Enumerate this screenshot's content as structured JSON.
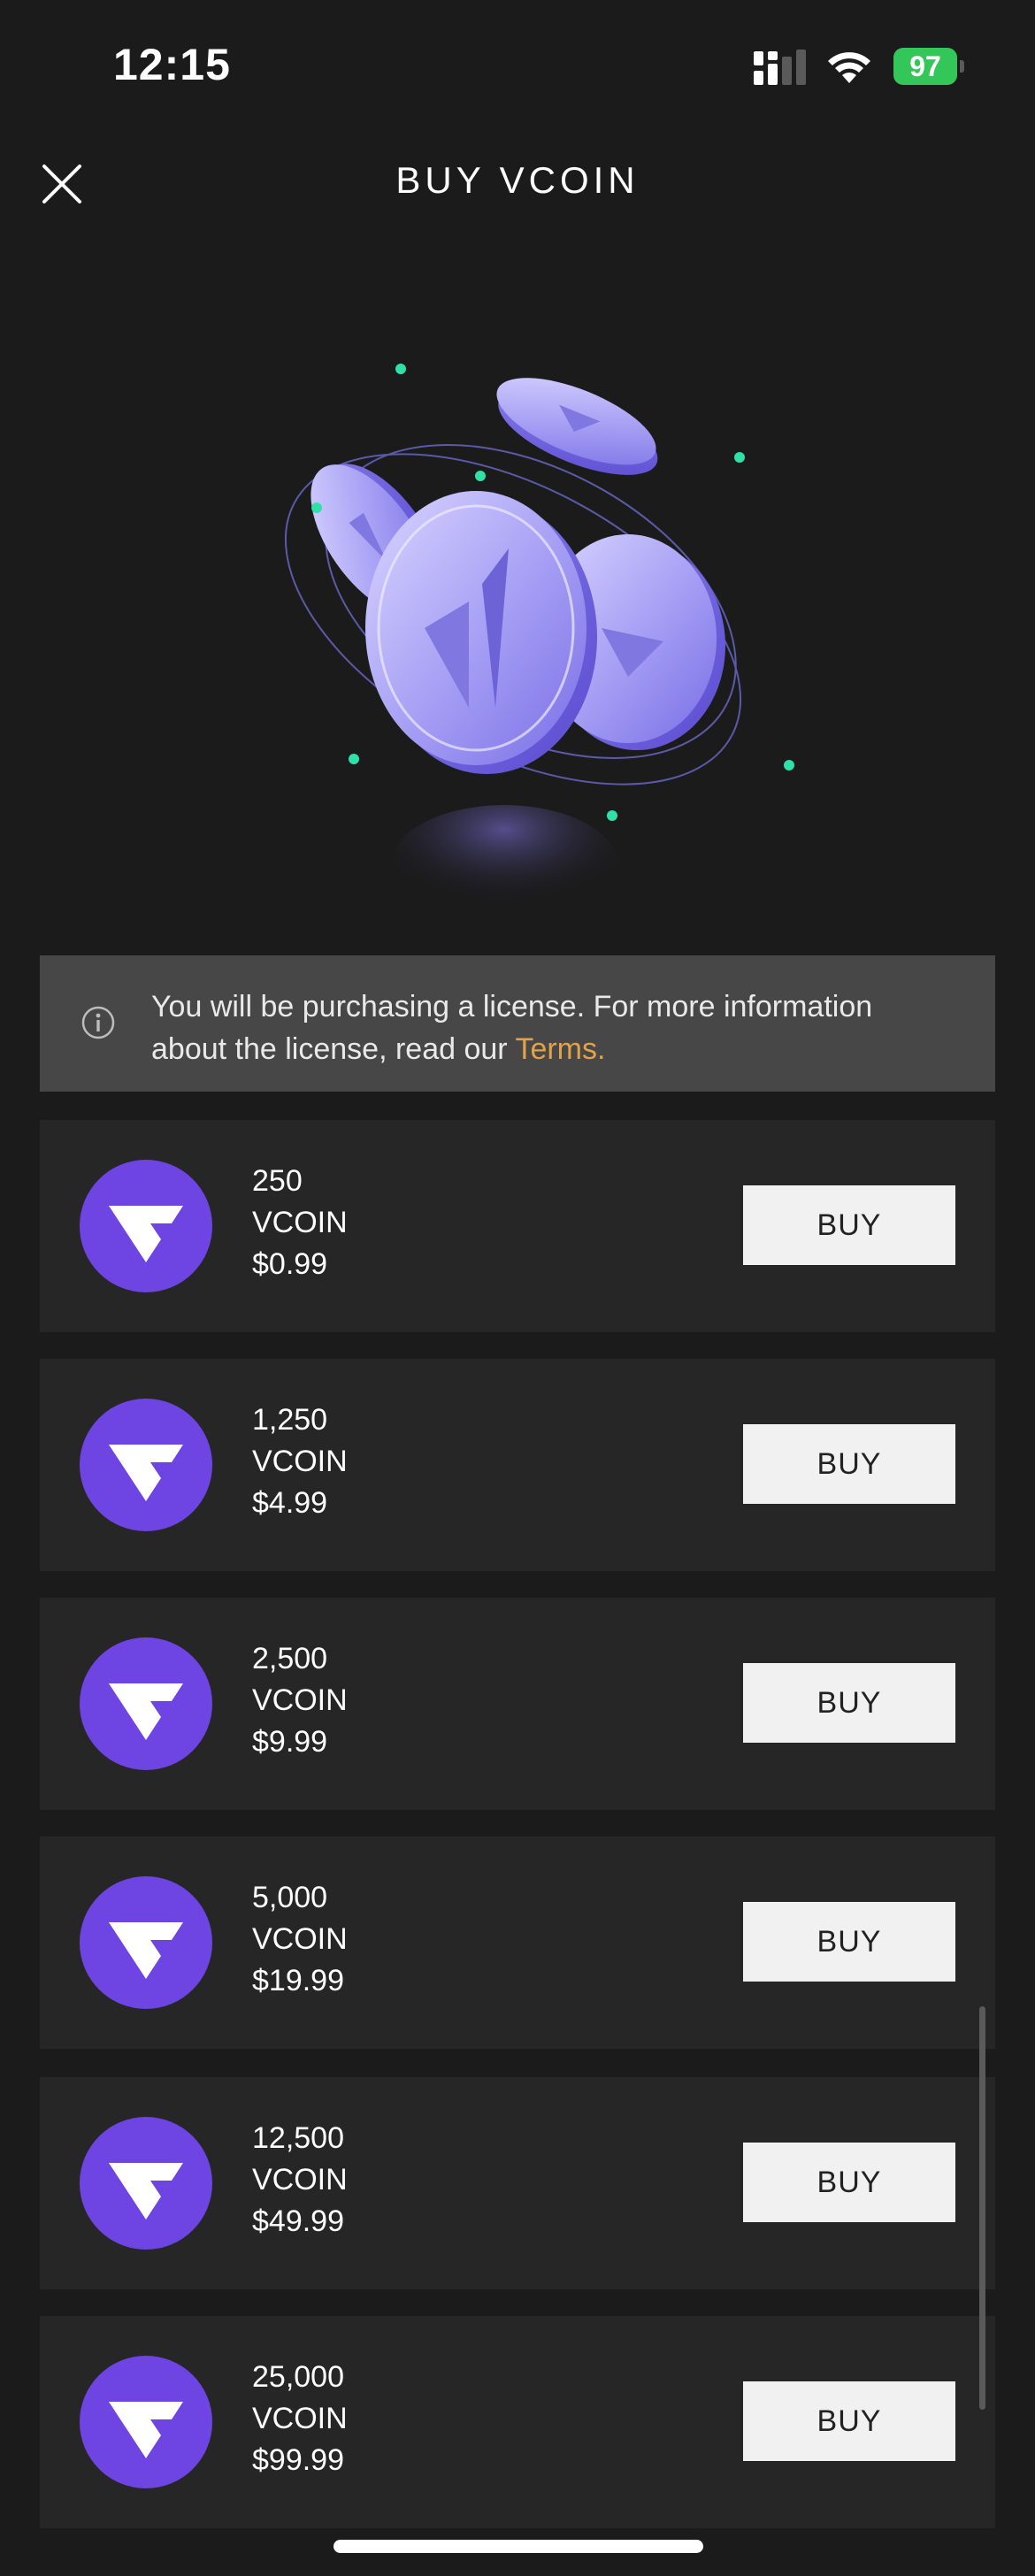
{
  "status_bar": {
    "time": "12:15",
    "battery": "97",
    "battery_color": "#33c759"
  },
  "header": {
    "title": "BUY VCOIN",
    "close_icon": "close-icon"
  },
  "notice": {
    "icon": "info-icon",
    "text_before": "You will be purchasing a license. For more information about the license, read our ",
    "link_text": "Terms.",
    "link_color": "#e3a24a"
  },
  "packages": [
    {
      "amount": "250",
      "currency": "VCOIN",
      "price": "$0.99",
      "button": "BUY"
    },
    {
      "amount": "1,250",
      "currency": "VCOIN",
      "price": "$4.99",
      "button": "BUY"
    },
    {
      "amount": "2,500",
      "currency": "VCOIN",
      "price": "$9.99",
      "button": "BUY"
    },
    {
      "amount": "5,000",
      "currency": "VCOIN",
      "price": "$19.99",
      "button": "BUY"
    },
    {
      "amount": "12,500",
      "currency": "VCOIN",
      "price": "$49.99",
      "button": "BUY"
    },
    {
      "amount": "25,000",
      "currency": "VCOIN",
      "price": "$99.99",
      "button": "BUY"
    }
  ],
  "colors": {
    "background": "#1b1b1c",
    "card": "#262627",
    "brand_purple": "#6e45e2",
    "button_bg": "#f1f1f1"
  }
}
